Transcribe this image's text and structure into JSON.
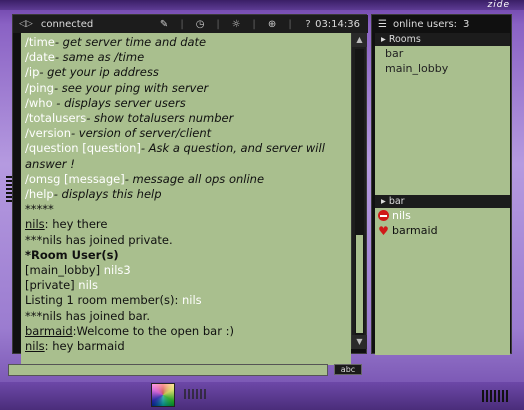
{
  "window": {
    "brand": "zide"
  },
  "status": {
    "connection": "connected",
    "clock": "03:14:36"
  },
  "chat": {
    "lines": [
      [
        {
          "t": "/time",
          "c": "cmd"
        },
        {
          "t": "- get server time and date",
          "c": "desc"
        }
      ],
      [
        {
          "t": "/date",
          "c": "cmd"
        },
        {
          "t": "- same as /time",
          "c": "desc"
        }
      ],
      [
        {
          "t": "/ip",
          "c": "cmd"
        },
        {
          "t": "- get your ip address",
          "c": "desc"
        }
      ],
      [
        {
          "t": "/ping",
          "c": "cmd"
        },
        {
          "t": "- see your ping with server",
          "c": "desc"
        }
      ],
      [
        {
          "t": "/who",
          "c": "cmd"
        },
        {
          "t": " - displays server users",
          "c": "desc"
        }
      ],
      [
        {
          "t": "/totalusers",
          "c": "cmd"
        },
        {
          "t": "- show totalusers number",
          "c": "desc"
        }
      ],
      [
        {
          "t": "/version",
          "c": "cmd"
        },
        {
          "t": "- version of server/client",
          "c": "desc"
        }
      ],
      [
        {
          "t": "/question [question]",
          "c": "cmd"
        },
        {
          "t": "- Ask a question, and server will answer !",
          "c": "desc"
        }
      ],
      [
        {
          "t": "/omsg [message]",
          "c": "cmd"
        },
        {
          "t": "- message all ops online",
          "c": "desc"
        }
      ],
      [
        {
          "t": "/help",
          "c": "cmd"
        },
        {
          "t": "- displays this help",
          "c": "desc"
        }
      ],
      [
        {
          "t": " ",
          "c": ""
        }
      ],
      [
        {
          "t": "*****",
          "c": ""
        }
      ],
      [
        {
          "t": "nils",
          "c": "u"
        },
        {
          "t": ": hey there",
          "c": ""
        }
      ],
      [
        {
          "t": "***nils has joined private.",
          "c": ""
        }
      ],
      [
        {
          "t": "*Room",
          "c": "b"
        },
        {
          "t": "      User(s)",
          "c": "b"
        }
      ],
      [
        {
          "t": "[main_lobby] ",
          "c": ""
        },
        {
          "t": "nils3",
          "c": "w"
        }
      ],
      [
        {
          "t": "[private] ",
          "c": ""
        },
        {
          "t": "nils",
          "c": "w"
        }
      ],
      [
        {
          "t": "Listing 1 room member(s): ",
          "c": ""
        },
        {
          "t": "nils",
          "c": "w"
        }
      ],
      [
        {
          "t": "***nils has joined bar.",
          "c": ""
        }
      ],
      [
        {
          "t": "barmaid",
          "c": "u"
        },
        {
          "t": ":Welcome to the open bar :)",
          "c": ""
        }
      ],
      [
        {
          "t": "nils",
          "c": "u"
        },
        {
          "t": ": hey barmaid",
          "c": ""
        }
      ]
    ],
    "input_value": "",
    "abc_label": "abc"
  },
  "users": {
    "header_label": "online users:",
    "count": "3",
    "rooms_title": "Rooms",
    "rooms": [
      "bar",
      "main_lobby"
    ],
    "current_room": "bar",
    "members": [
      {
        "name": "nils",
        "icon": "no-entry-icon",
        "style": "light"
      },
      {
        "name": "barmaid",
        "icon": "heart-icon",
        "style": "dark"
      }
    ]
  }
}
